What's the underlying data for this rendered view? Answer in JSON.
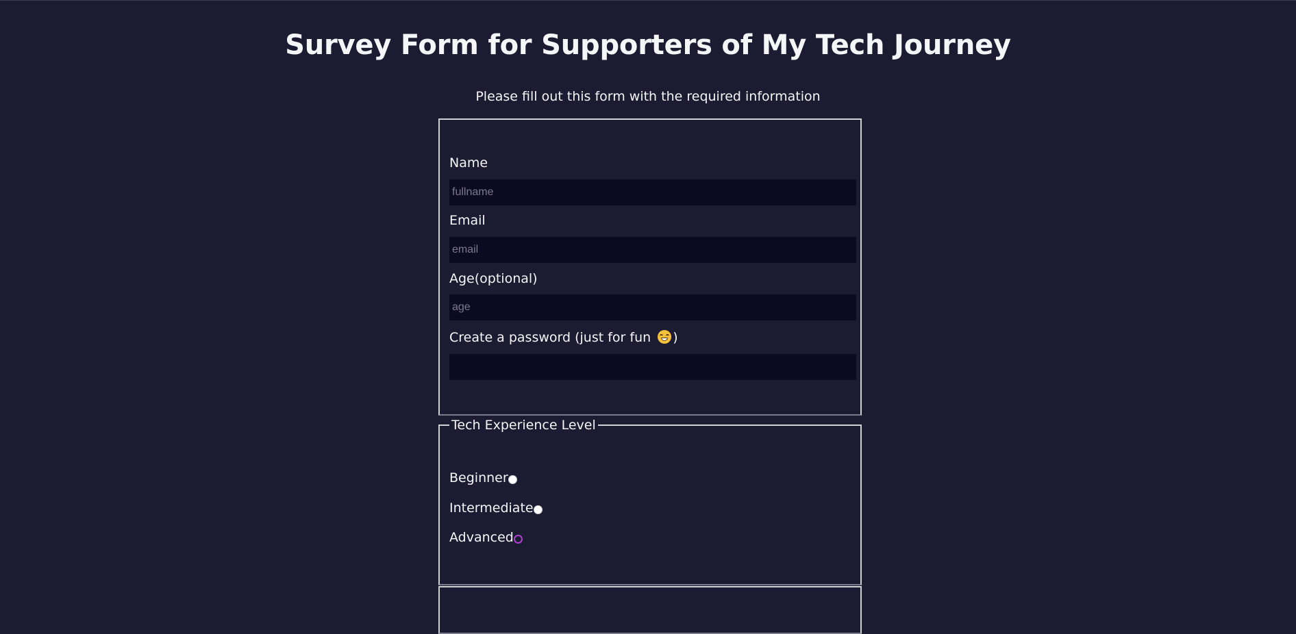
{
  "header": {
    "title": "Survey Form for Supporters of My Tech Journey",
    "description": "Please fill out this form with the required information"
  },
  "personal": {
    "name_label": "Name",
    "name_placeholder": "fullname",
    "email_label": "Email",
    "email_placeholder": "email",
    "age_label": "Age(optional)",
    "age_placeholder": "age",
    "password_label_before": "Create a password (just for fun ",
    "password_label_after": ")",
    "password_emoji": "grinning-face-icon"
  },
  "experience": {
    "legend": "Tech Experience Level",
    "options": [
      {
        "label": "Beginner",
        "state": "unchecked"
      },
      {
        "label": "Intermediate",
        "state": "unchecked"
      },
      {
        "label": "Advanced",
        "state": "focused"
      }
    ]
  },
  "colors": {
    "background": "#1b1b32",
    "input_background": "#0a0a23",
    "text": "#f5f6f7",
    "focus_ring": "#b040d0"
  }
}
